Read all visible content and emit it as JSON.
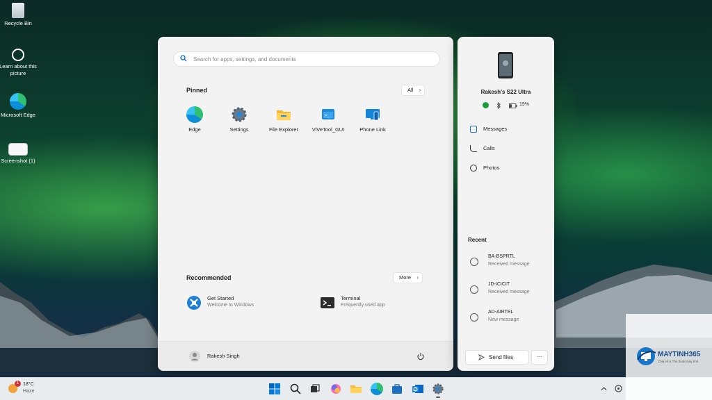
{
  "desktop": {
    "icons": [
      {
        "label": "Recycle Bin",
        "icon": "recycle-bin-icon"
      },
      {
        "label": "Learn about this picture",
        "icon": "learn-about-picture-icon"
      },
      {
        "label": "Microsoft Edge",
        "icon": "edge-icon"
      },
      {
        "label": "Screenshot (1)",
        "icon": "screenshot-file-icon"
      }
    ]
  },
  "start_menu": {
    "search_placeholder": "Search for apps, settings, and documents",
    "pinned_title": "Pinned",
    "all_label": "All",
    "pinned_apps": [
      {
        "label": "Edge",
        "icon": "edge-icon"
      },
      {
        "label": "Settings",
        "icon": "settings-gear-icon"
      },
      {
        "label": "File Explorer",
        "icon": "folder-icon"
      },
      {
        "label": "ViVeTool_GUI",
        "icon": "vivetool-icon"
      },
      {
        "label": "Phone Link",
        "icon": "phone-link-icon"
      }
    ],
    "recommended_title": "Recommended",
    "more_label": "More",
    "recommended": [
      {
        "title": "Get Started",
        "subtitle": "Welcome to Windows",
        "icon": "get-started-icon"
      },
      {
        "title": "Terminal",
        "subtitle": "Frequently used app",
        "icon": "terminal-icon"
      }
    ],
    "user_name": "Rakesh Singh"
  },
  "phone_panel": {
    "device_name": "Rakesh's S22 Ultra",
    "battery": "19%",
    "menu": [
      {
        "label": "Messages",
        "icon": "messages-icon"
      },
      {
        "label": "Calls",
        "icon": "calls-icon"
      },
      {
        "label": "Photos",
        "icon": "photos-icon"
      }
    ],
    "recent_title": "Recent",
    "recent": [
      {
        "sender": "BA-BSPRTL",
        "status": "Received message"
      },
      {
        "sender": "JD-ICICIT",
        "status": "Received message"
      },
      {
        "sender": "AD-AIRTEL",
        "status": "New message"
      }
    ],
    "send_files_label": "Send files",
    "more_options": "···"
  },
  "taskbar": {
    "weather_temp": "18°C",
    "weather_desc": "Haze",
    "weather_badge": "1",
    "watermark": {
      "brand": "MAYTINH365",
      "tagline": "Chia sẻ & Thủ thuật máy tính"
    },
    "colors": {
      "accent": "#0067c0",
      "green_dot": "#1a9e3c"
    }
  }
}
